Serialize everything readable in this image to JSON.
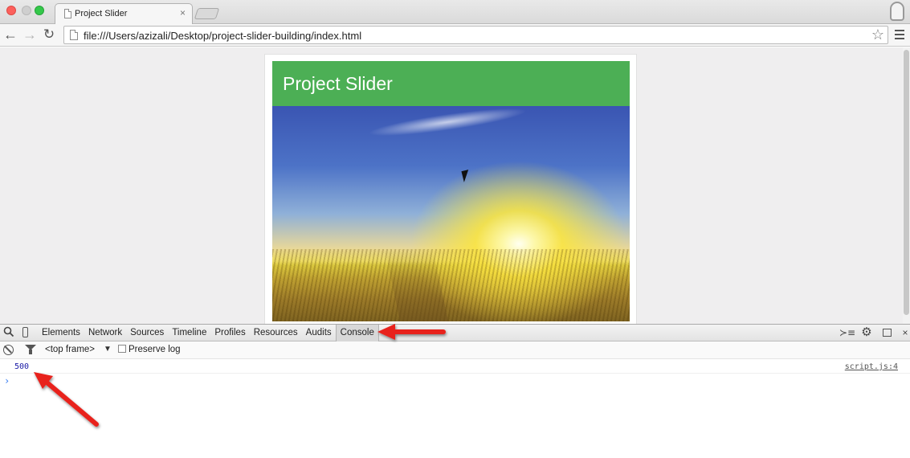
{
  "browser": {
    "tab_title": "Project Slider",
    "tab_close": "×",
    "url": "file:///Users/azizali/Desktop/project-slider-building/index.html"
  },
  "page": {
    "slider_title": "Project Slider"
  },
  "devtools": {
    "tabs": [
      {
        "label": "Elements"
      },
      {
        "label": "Network"
      },
      {
        "label": "Sources"
      },
      {
        "label": "Timeline"
      },
      {
        "label": "Profiles"
      },
      {
        "label": "Resources"
      },
      {
        "label": "Audits"
      },
      {
        "label": "Console"
      }
    ],
    "active_tab": "Console",
    "frame": "<top frame>",
    "preserve_log": "Preserve log",
    "close": "×"
  },
  "console": {
    "output_value": "500",
    "source_link": "script.js:4",
    "prompt": "›"
  },
  "colors": {
    "header_green": "#4caf55",
    "annotation_red": "#e8231c",
    "console_number": "#1a1aa6"
  }
}
